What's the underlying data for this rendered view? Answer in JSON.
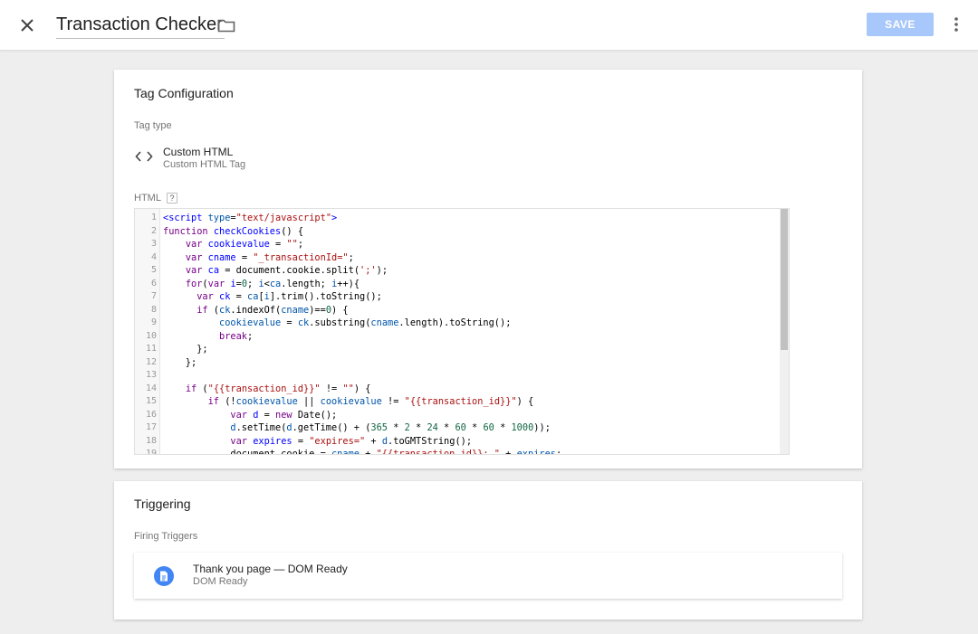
{
  "header": {
    "title": "Transaction Checker",
    "save_label": "SAVE",
    "close_icon": "close-icon",
    "folder_icon": "folder-icon",
    "more_icon": "more-vert-icon"
  },
  "config": {
    "title": "Tag Configuration",
    "tag_type_label": "Tag type",
    "tag_type_name": "Custom HTML",
    "tag_type_sub": "Custom HTML Tag",
    "html_label": "HTML",
    "help": "?",
    "code_lines": [
      "1",
      "2",
      "3",
      "4",
      "5",
      "6",
      "7",
      "8",
      "9",
      "10",
      "11",
      "12",
      "13",
      "14",
      "15",
      "16",
      "17",
      "18",
      "19"
    ]
  },
  "triggering": {
    "title": "Triggering",
    "firing_label": "Firing Triggers",
    "trigger_name": "Thank you page — DOM Ready",
    "trigger_sub": "DOM Ready"
  },
  "colors": {
    "save_disabled": "#a8c7fa",
    "trigger_icon": "#4285f4",
    "background": "#eeeeee"
  }
}
